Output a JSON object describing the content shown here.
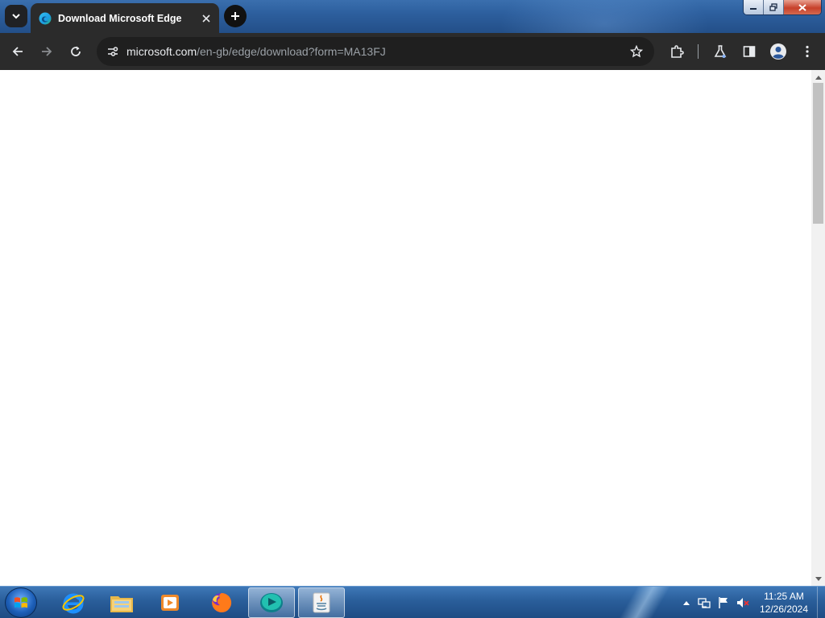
{
  "browser": {
    "tab": {
      "title": "Download Microsoft Edge",
      "favicon": "edge-logo-icon"
    },
    "address_bar": {
      "host": "microsoft.com",
      "path": "/en-gb/edge/download?form=MA13FJ"
    },
    "toolbar_icons": [
      "back-arrow-icon",
      "forward-arrow-icon",
      "reload-icon",
      "site-info-icon",
      "bookmark-star-icon",
      "extensions-icon",
      "labs-flask-icon",
      "side-panel-icon",
      "profile-icon",
      "menu-dots-icon"
    ]
  },
  "taskbar": {
    "pinned_apps": [
      "internet-explorer-icon",
      "file-explorer-icon",
      "media-player-icon",
      "firefox-icon",
      "edge-installer-icon",
      "java-icon"
    ],
    "clock": {
      "time": "11:25 AM",
      "date": "12/26/2024"
    }
  },
  "colors": {
    "tab_strip": "#2d5f9e",
    "toolbar": "#2b2b2b",
    "omnibox": "#1f1f1f",
    "taskbar": "#2a5e9a"
  }
}
